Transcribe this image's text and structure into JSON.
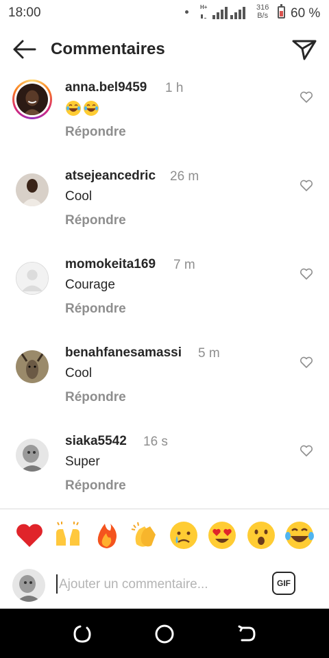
{
  "status_bar": {
    "time": "18:00",
    "network": "H+",
    "speed_value": "316",
    "speed_unit": "B/s",
    "battery": "60 %"
  },
  "header": {
    "title": "Commentaires",
    "back_icon": "arrow-left-icon",
    "send_icon": "paper-plane-icon"
  },
  "comments": [
    {
      "username": "anna.bel9459",
      "time": "1 h",
      "text": "",
      "emoji": [
        "face-with-tears-of-joy",
        "face-with-tears-of-joy"
      ],
      "reply": "Répondre",
      "has_story": true
    },
    {
      "username": "atsejeancedric",
      "time": "26 m",
      "text": "Cool",
      "reply": "Répondre"
    },
    {
      "username": "momokeita169",
      "time": "7 m",
      "text": "Courage",
      "reply": "Répondre"
    },
    {
      "username": "benahfanesamassi",
      "time": "5 m",
      "text": "Cool",
      "reply": "Répondre"
    },
    {
      "username": "siaka5542",
      "time": "16 s",
      "text": "Super",
      "reply": "Répondre"
    }
  ],
  "emoji_bar": [
    "red-heart",
    "raising-hands",
    "fire",
    "clapping-hands",
    "crying-face",
    "heart-eyes",
    "face-with-open-mouth",
    "face-with-tears-of-joy"
  ],
  "input": {
    "placeholder": "Ajouter un commentaire...",
    "gif_label": "GIF"
  },
  "colors": {
    "text": "#262626",
    "secondary": "#8e8e8e",
    "placeholder": "#b4b4b4"
  }
}
